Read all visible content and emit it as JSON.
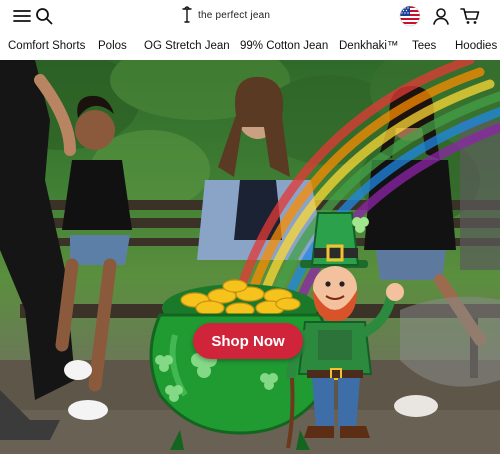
{
  "header": {
    "brand_name": "the perfect jean",
    "icons": [
      "menu-icon",
      "search-icon",
      "us-flag-icon",
      "account-icon",
      "cart-icon"
    ]
  },
  "nav": {
    "items": [
      {
        "label": "Comfort Shorts"
      },
      {
        "label": "Polos"
      },
      {
        "label": "OG Stretch Jean"
      },
      {
        "label": "99% Cotton Jean"
      },
      {
        "label": "Denkhaki™"
      },
      {
        "label": "Tees"
      },
      {
        "label": "Hoodies"
      }
    ]
  },
  "hero": {
    "cta_label": "Shop Now",
    "accent_color": "#d0243a"
  }
}
